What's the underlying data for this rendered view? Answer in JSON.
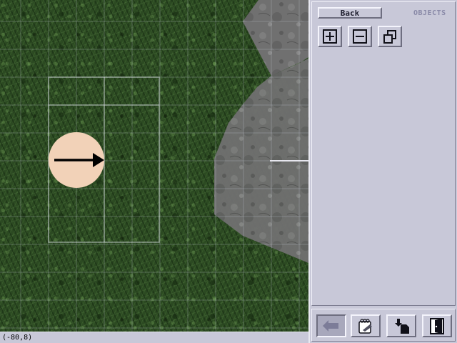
{
  "panel": {
    "back_label": "Back",
    "objects_label": "OBJECTS",
    "tools": [
      {
        "name": "add-object",
        "icon": "plus-box-icon"
      },
      {
        "name": "remove-object",
        "icon": "minus-box-icon"
      },
      {
        "name": "duplicate-object",
        "icon": "duplicate-icon"
      }
    ],
    "bottom_buttons": [
      {
        "name": "undo",
        "icon": "undo-arrow-icon",
        "pressed": true
      },
      {
        "name": "edit",
        "icon": "notepad-icon"
      },
      {
        "name": "load",
        "icon": "download-file-icon"
      },
      {
        "name": "exit",
        "icon": "door-exit-icon"
      }
    ]
  },
  "status": {
    "coordinates": "(-80,8)"
  },
  "colors": {
    "panel": "#c8c8d8",
    "grass": "#2c4a22",
    "rock": "#6e6e6e",
    "token": "#f2d2b8"
  }
}
